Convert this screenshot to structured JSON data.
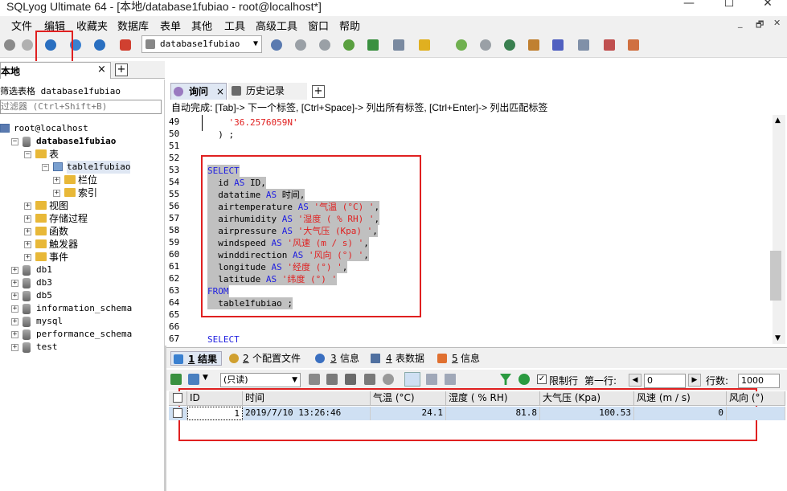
{
  "window": {
    "title": "SQLyog Ultimate 64 - [本地/database1fubiao - root@localhost*]",
    "minimize_glyph": "—",
    "maximize_glyph": "☐",
    "close_glyph": "✕"
  },
  "menu": [
    "文件",
    "编辑",
    "收藏夹",
    "数据库",
    "表单",
    "其他",
    "工具",
    "高级工具",
    "窗口",
    "帮助"
  ],
  "mdi_controls": [
    "_",
    "🗗",
    "✕"
  ],
  "toolbar": {
    "database_selector": "database1fubiao",
    "icons": [
      "connect-icon",
      "refresh-icon",
      "execute-query-icon",
      "execute-all-icon",
      "stop-icon",
      "new-database-icon"
    ]
  },
  "connection_tab": {
    "label": "本地",
    "close": "×",
    "add": "+"
  },
  "left_panel": {
    "filter_label": "筛选表格 database1fubiao",
    "filter_placeholder": "过滤器 (Ctrl+Shift+B)",
    "tree": [
      {
        "label": "root@localhost",
        "level": 0,
        "type": "server"
      },
      {
        "label": "database1fubiao",
        "level": 1,
        "type": "db",
        "bold": true,
        "expanded": true
      },
      {
        "label": "表",
        "level": 2,
        "type": "folder",
        "expanded": true
      },
      {
        "label": "table1fubiao",
        "level": 3,
        "type": "table",
        "expanded": true
      },
      {
        "label": "栏位",
        "level": 4,
        "type": "folder"
      },
      {
        "label": "索引",
        "level": 4,
        "type": "folder"
      },
      {
        "label": "视图",
        "level": 2,
        "type": "folder"
      },
      {
        "label": "存储过程",
        "level": 2,
        "type": "folder"
      },
      {
        "label": "函数",
        "level": 2,
        "type": "folder"
      },
      {
        "label": "触发器",
        "level": 2,
        "type": "folder"
      },
      {
        "label": "事件",
        "level": 2,
        "type": "folder"
      },
      {
        "label": "db1",
        "level": 1,
        "type": "db"
      },
      {
        "label": "db3",
        "level": 1,
        "type": "db"
      },
      {
        "label": "db5",
        "level": 1,
        "type": "db"
      },
      {
        "label": "information_schema",
        "level": 1,
        "type": "db"
      },
      {
        "label": "mysql",
        "level": 1,
        "type": "db"
      },
      {
        "label": "performance_schema",
        "level": 1,
        "type": "db"
      },
      {
        "label": "test",
        "level": 1,
        "type": "db"
      }
    ]
  },
  "query_tabs": [
    {
      "label": "询问",
      "active": true,
      "close": "×"
    },
    {
      "label": "历史记录",
      "active": false
    }
  ],
  "autocomplete_hint": "自动完成: [Tab]-> 下一个标签, [Ctrl+Space]-> 列出所有标签, [Ctrl+Enter]-> 列出匹配标签",
  "editor": {
    "lines": [
      {
        "n": "49",
        "parts": [
          [
            "str",
            "    '36.2576059N'"
          ]
        ]
      },
      {
        "n": "50",
        "parts": [
          [
            "txt",
            "  ) ;"
          ]
        ]
      },
      {
        "n": "51",
        "parts": []
      },
      {
        "n": "52",
        "parts": []
      },
      {
        "n": "53",
        "sel": true,
        "parts": [
          [
            "kw",
            "SELECT"
          ]
        ]
      },
      {
        "n": "54",
        "sel": true,
        "parts": [
          [
            "txt",
            "  id "
          ],
          [
            "kw",
            "AS"
          ],
          [
            "txt",
            " ID,"
          ]
        ]
      },
      {
        "n": "55",
        "sel": true,
        "parts": [
          [
            "txt",
            "  datatime "
          ],
          [
            "kw",
            "AS"
          ],
          [
            "txt",
            " 时间,"
          ]
        ]
      },
      {
        "n": "56",
        "sel": true,
        "parts": [
          [
            "txt",
            "  airtemperature "
          ],
          [
            "kw",
            "AS"
          ],
          [
            "str",
            " '气温 (°C) '"
          ],
          [
            "txt",
            ","
          ]
        ]
      },
      {
        "n": "57",
        "sel": true,
        "parts": [
          [
            "txt",
            "  airhumidity "
          ],
          [
            "kw",
            "AS"
          ],
          [
            "str",
            " '湿度 ( % RH) '"
          ],
          [
            "txt",
            ","
          ]
        ]
      },
      {
        "n": "58",
        "sel": true,
        "parts": [
          [
            "txt",
            "  airpressure "
          ],
          [
            "kw",
            "AS"
          ],
          [
            "str",
            " '大气压 (Kpa) '"
          ],
          [
            "txt",
            ","
          ]
        ]
      },
      {
        "n": "59",
        "sel": true,
        "parts": [
          [
            "txt",
            "  windspeed "
          ],
          [
            "kw",
            "AS"
          ],
          [
            "str",
            " '风速 (m / s) '"
          ],
          [
            "txt",
            ","
          ]
        ]
      },
      {
        "n": "60",
        "sel": true,
        "parts": [
          [
            "txt",
            "  winddirection "
          ],
          [
            "kw",
            "AS"
          ],
          [
            "str",
            " '风向 (°) '"
          ],
          [
            "txt",
            ","
          ]
        ]
      },
      {
        "n": "61",
        "sel": true,
        "parts": [
          [
            "txt",
            "  longitude "
          ],
          [
            "kw",
            "AS"
          ],
          [
            "str",
            " '经度 (°) '"
          ],
          [
            "txt",
            ","
          ]
        ]
      },
      {
        "n": "62",
        "sel": true,
        "parts": [
          [
            "txt",
            "  latitude "
          ],
          [
            "kw",
            "AS"
          ],
          [
            "str",
            " '纬度 (°) '"
          ]
        ]
      },
      {
        "n": "63",
        "sel": true,
        "parts": [
          [
            "kw",
            "FROM"
          ]
        ]
      },
      {
        "n": "64",
        "sel": true,
        "parts": [
          [
            "txt",
            "  table1fubiao ;"
          ]
        ]
      },
      {
        "n": "65",
        "parts": []
      },
      {
        "n": "66",
        "parts": []
      },
      {
        "n": "67",
        "parts": [
          [
            "kw",
            "SELECT"
          ]
        ]
      }
    ]
  },
  "result_tabs": [
    {
      "num": "1",
      "label": "结果",
      "active": true
    },
    {
      "num": "2",
      "label": "个配置文件"
    },
    {
      "num": "3",
      "label": "信息"
    },
    {
      "num": "4",
      "label": "表数据"
    },
    {
      "num": "5",
      "label": "信息"
    }
  ],
  "result_toolbar": {
    "mode_select": "(只读)",
    "limit_rows_label": "限制行",
    "limit_rows_checked": true,
    "first_row_label": "第一行:",
    "first_row_value": "0",
    "rows_label": "行数:",
    "rows_value": "1000"
  },
  "grid": {
    "columns": [
      "ID",
      "时间",
      "气温 (°C)",
      "湿度 ( % RH)",
      "大气压 (Kpa)",
      "风速 (m / s)",
      "风向 (°)"
    ],
    "rows": [
      [
        "1",
        "2019/7/10 13:26:46",
        "24.1",
        "81.8",
        "100.53",
        "0",
        ""
      ]
    ]
  },
  "colors": {
    "highlight": "#e02020",
    "keyword": "#2020e0",
    "string": "#e02020",
    "selection": "#c0c0c0",
    "row_selected": "#cfe0f3"
  }
}
